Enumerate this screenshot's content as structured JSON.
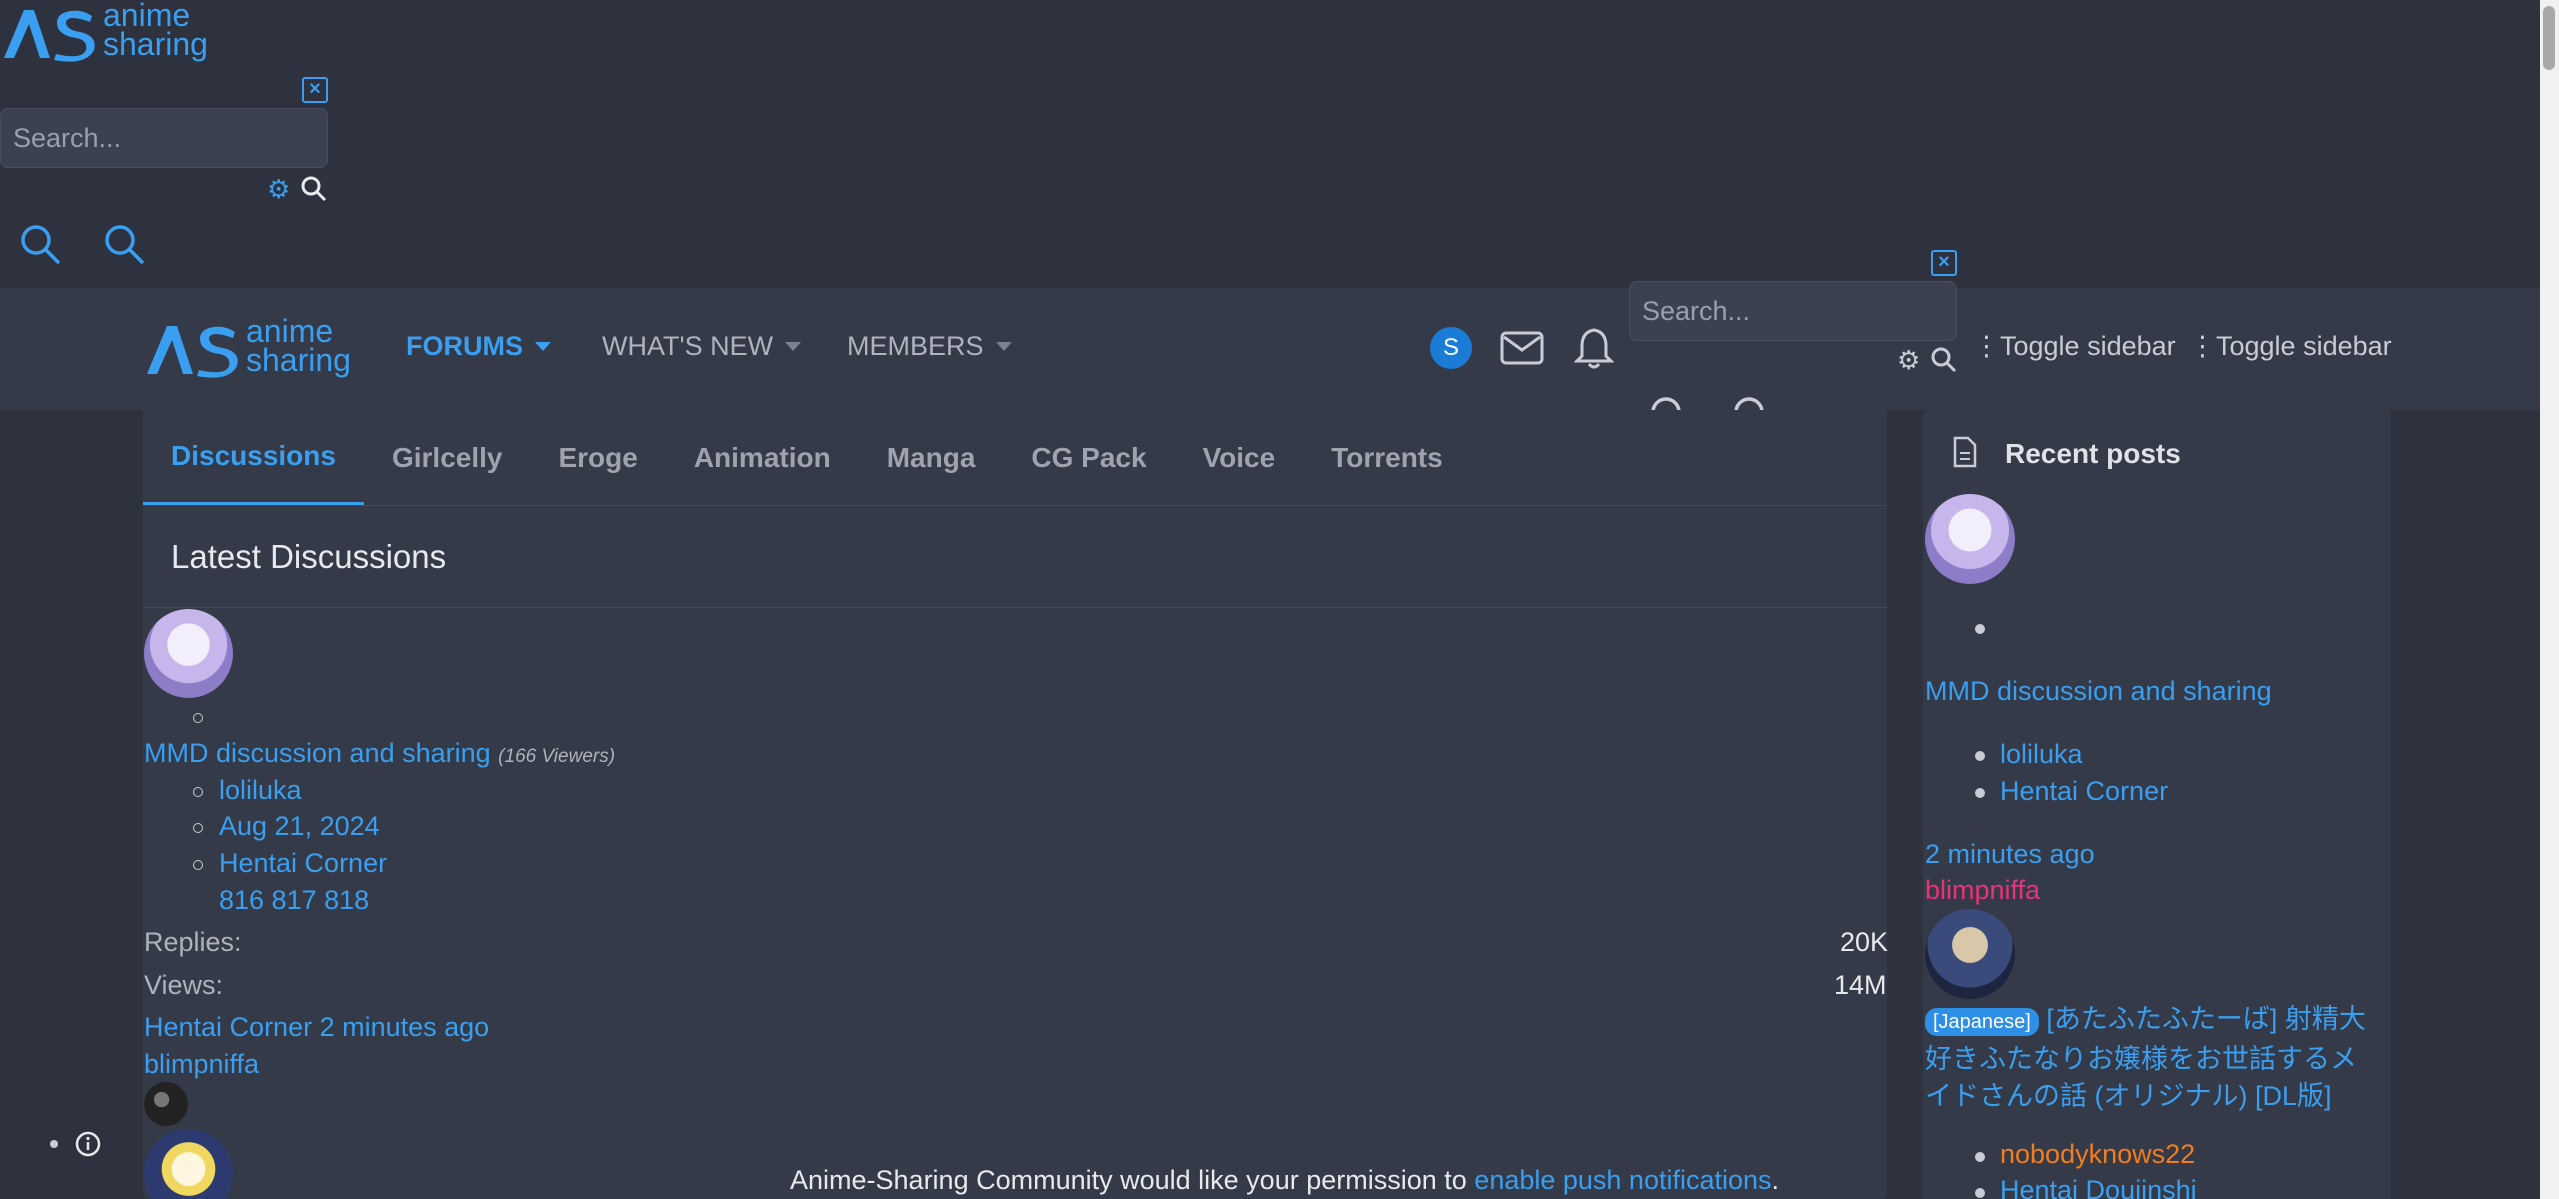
{
  "brand": {
    "line1": "anime",
    "line2": "sharing",
    "accent": "#3a9ff0"
  },
  "search": {
    "placeholder": "Search..."
  },
  "nav": {
    "items": [
      {
        "label": "FORUMS"
      },
      {
        "label": "WHAT'S NEW"
      },
      {
        "label": "MEMBERS"
      }
    ],
    "user_initial": "S",
    "toggle_sidebar": "Toggle sidebar"
  },
  "tabs": [
    "Discussions",
    "Girlcelly",
    "Eroge",
    "Animation",
    "Manga",
    "CG Pack",
    "Voice",
    "Torrents"
  ],
  "main": {
    "section_title": "Latest Discussions",
    "thread": {
      "title": "MMD discussion and sharing",
      "viewers": "(166 Viewers)",
      "author": "loliluka",
      "date": "Aug 21, 2024",
      "forum": "Hentai Corner",
      "pages": "816 817 818",
      "replies_label": "Replies:",
      "replies_value": "20K",
      "views_label": "Views:",
      "views_value": "14M",
      "last_forum_time": "Hentai Corner 2 minutes ago",
      "last_user": "blimpniffa"
    },
    "push_text": "Anime-Sharing Community would like your permission to",
    "push_link": "enable push notifications",
    "push_end": "."
  },
  "sidebar": {
    "title": "Recent posts",
    "post1": {
      "title": "MMD discussion and sharing",
      "author": "loliluka",
      "forum": "Hentai Corner",
      "time": "2 minutes ago",
      "last_user": "blimpniffa"
    },
    "post2": {
      "tag": "[Japanese]",
      "title": "[あたふたふたーば] 射精大好きふたなりお嬢様をお世話するメイドさんの話 (オリジナル) [DL版]",
      "author": "nobodyknows22",
      "forum": "Hentai Doujinshi"
    }
  }
}
